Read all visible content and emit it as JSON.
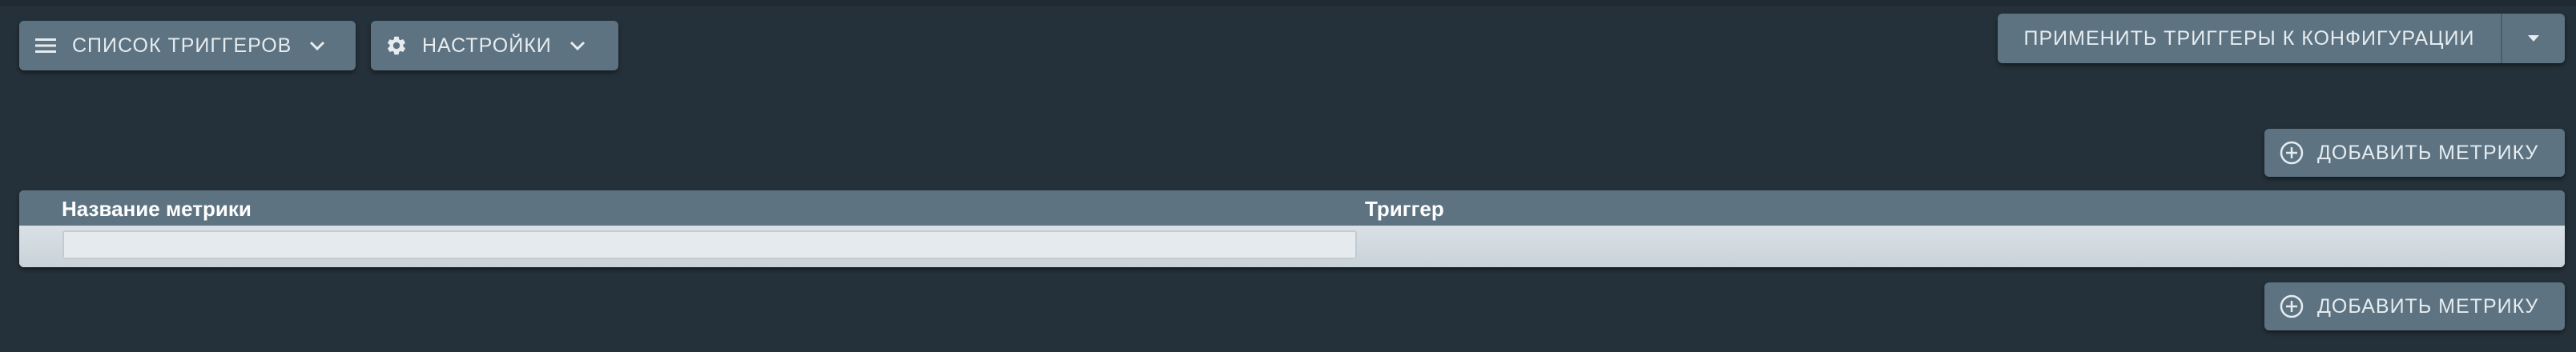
{
  "toolbar": {
    "trigger_list_label": "СПИСОК ТРИГГЕРОВ",
    "settings_label": "НАСТРОЙКИ",
    "apply_label": "ПРИМЕНИТЬ ТРИГГЕРЫ К КОНФИГУРАЦИИ"
  },
  "actions": {
    "add_metric_label": "ДОБАВИТЬ МЕТРИКУ"
  },
  "table": {
    "columns": [
      "Название метрики",
      "Триггер"
    ],
    "rows": [
      {
        "metric_name": "",
        "trigger": ""
      }
    ]
  },
  "colors": {
    "background": "#25313a",
    "button": "#5d7382",
    "button_text": "#e6ecef",
    "table_body": "#d5dde2"
  }
}
